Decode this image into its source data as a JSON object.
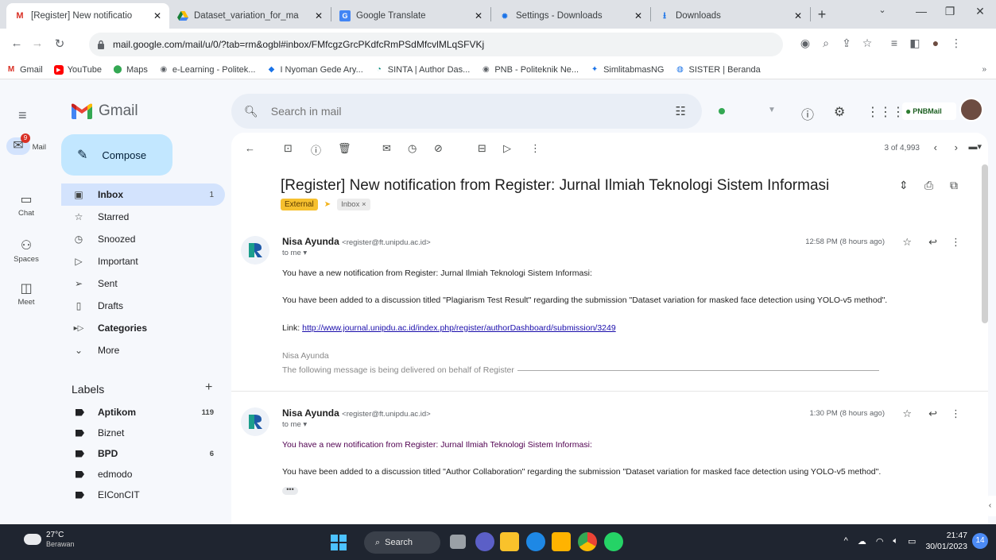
{
  "browser": {
    "tabs": [
      {
        "title": "[Register] New notificatio",
        "favicon": "gmail-m",
        "active": true
      },
      {
        "title": "Dataset_variation_for_ma",
        "favicon": "drive"
      },
      {
        "title": "Google Translate",
        "favicon": "translate"
      },
      {
        "title": "Settings - Downloads",
        "favicon": "gear"
      },
      {
        "title": "Downloads",
        "favicon": "download"
      }
    ],
    "new_tab": "+",
    "url": "mail.google.com/mail/u/0/?tab=rm&ogbl#inbox/FMfcgzGrcPKdfcRmPSdMfcvlMLqSFVKj",
    "bookmarks": [
      "Gmail",
      "YouTube",
      "Maps",
      "e-Learning - Politek...",
      "I Nyoman Gede Ary...",
      "SINTA | Author Das...",
      "PNB - Politeknik Ne...",
      "SimlitabmasNG",
      "SISTER | Beranda"
    ]
  },
  "gmail": {
    "logo_text": "Gmail",
    "search_placeholder": "Search in mail",
    "org_logo": "PNBMail",
    "rail": [
      {
        "label": "Mail",
        "icon": "mail-icon",
        "badge": "9"
      },
      {
        "label": "Chat",
        "icon": "chat-icon"
      },
      {
        "label": "Spaces",
        "icon": "spaces-icon"
      },
      {
        "label": "Meet",
        "icon": "meet-icon"
      }
    ],
    "compose": "Compose",
    "nav": [
      {
        "label": "Inbox",
        "count": "1",
        "icon": "inbox-icon",
        "active": true
      },
      {
        "label": "Starred",
        "count": "",
        "icon": "star-icon"
      },
      {
        "label": "Snoozed",
        "count": "",
        "icon": "clock-icon"
      },
      {
        "label": "Important",
        "count": "",
        "icon": "important-icon"
      },
      {
        "label": "Sent",
        "count": "",
        "icon": "send-icon"
      },
      {
        "label": "Drafts",
        "count": "",
        "icon": "draft-icon"
      },
      {
        "label": "Categories",
        "count": "",
        "icon": "label-icon",
        "bold": true
      },
      {
        "label": "More",
        "count": "",
        "icon": "chevron-down-icon"
      }
    ],
    "labels_title": "Labels",
    "labels_add": "+",
    "labels": [
      {
        "name": "Aptikom",
        "count": "119",
        "bold": true
      },
      {
        "name": "Biznet",
        "count": ""
      },
      {
        "name": "BPD",
        "count": "6",
        "bold": true
      },
      {
        "name": "edmodo",
        "count": ""
      },
      {
        "name": "EIConCIT",
        "count": ""
      }
    ]
  },
  "thread": {
    "pager": "3 of 4,993",
    "subject": "[Register] New notification from Register: Jurnal Ilmiah Teknologi Sistem Informasi",
    "chip_external": "External",
    "chip_inbox": "Inbox ×",
    "messages": [
      {
        "sender": "Nisa Ayunda",
        "email": "<register@ft.unipdu.ac.id>",
        "to": "to me ▾",
        "time": "12:58 PM (8 hours ago)",
        "body": [
          "You have a new notification from Register: Jurnal Ilmiah Teknologi Sistem Informasi:",
          "You have been added to a discussion titled \"Plagiarism Test Result\" regarding the submission \"Dataset variation for masked face detection using YOLO-v5 method\"."
        ],
        "link_label": "Link:",
        "link": "http://www.journal.unipdu.ac.id/index.php/register/authorDashboard/submission/3249",
        "signature": "Nisa Ayunda",
        "footer": "The following message is being delivered on behalf of Register"
      },
      {
        "sender": "Nisa Ayunda",
        "email": "<register@ft.unipdu.ac.id>",
        "to": "to me ▾",
        "time": "1:30 PM (8 hours ago)",
        "body": [
          "You have a new notification from Register: Jurnal Ilmiah Teknologi Sistem Informasi:",
          "You have been added to a discussion titled \"Author Collaboration\" regarding the submission \"Dataset variation for masked face detection using YOLO-v5 method\"."
        ],
        "dots": "•••"
      }
    ]
  },
  "taskbar": {
    "temp": "27°C",
    "weather": "Berawan",
    "search": "Search",
    "time": "21:47",
    "date": "30/01/2023",
    "notifications": "14"
  },
  "colors": {
    "accent": "#0b57d0",
    "inbox_active": "#d3e3fd",
    "compose": "#c2e7ff",
    "external_chip": "#f6c02e"
  }
}
